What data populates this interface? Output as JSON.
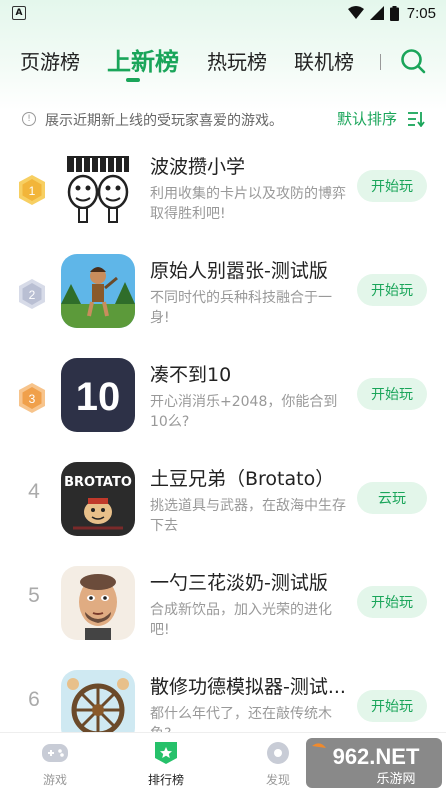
{
  "status_bar": {
    "notification_icon": "A",
    "time": "7:05",
    "icons": [
      "wifi-icon",
      "signal-icon",
      "battery-icon"
    ]
  },
  "tabs": [
    {
      "label": "页游榜",
      "active": false
    },
    {
      "label": "上新榜",
      "active": true
    },
    {
      "label": "热玩榜",
      "active": false
    },
    {
      "label": "联机榜",
      "active": false
    }
  ],
  "description": {
    "text": "展示近期新上线的受玩家喜爱的游戏。",
    "sort_label": "默认排序"
  },
  "games": [
    {
      "rank": "1",
      "title": "波波攒小学",
      "desc": "利用收集的卡片以及攻防的博弈取得胜利吧!",
      "action": "开始玩"
    },
    {
      "rank": "2",
      "title": "原始人别嚣张-测试版",
      "desc": "不同时代的兵种科技融合于一身!",
      "action": "开始玩"
    },
    {
      "rank": "3",
      "title": "凑不到10",
      "desc": "开心消消乐+2048，你能合到10么?",
      "action": "开始玩"
    },
    {
      "rank": "4",
      "title": "土豆兄弟（Brotato）",
      "desc": "挑选道具与武器，在敌海中生存下去",
      "action": "云玩"
    },
    {
      "rank": "5",
      "title": "一勺三花淡奶-测试版",
      "desc": "合成新饮品，加入光荣的进化吧!",
      "action": "开始玩"
    },
    {
      "rank": "6",
      "title": "散修功德模拟器-测试...",
      "desc": "都什么年代了，还在敲传统木鱼?",
      "action": "开始玩"
    }
  ],
  "icon_text": {
    "game3": "10",
    "game4": "BROTATO"
  },
  "bottom_nav": [
    {
      "label": "游戏",
      "active": false
    },
    {
      "label": "排行榜",
      "active": true
    },
    {
      "label": "发现",
      "active": false
    }
  ],
  "watermark": {
    "logo": "962.NET",
    "text": "乐游网"
  },
  "colors": {
    "accent": "#1aa55a",
    "button_bg": "#e3f6ea",
    "gold": "#f2b53a",
    "silver": "#b9bfd3",
    "bronze": "#f0a04b"
  }
}
